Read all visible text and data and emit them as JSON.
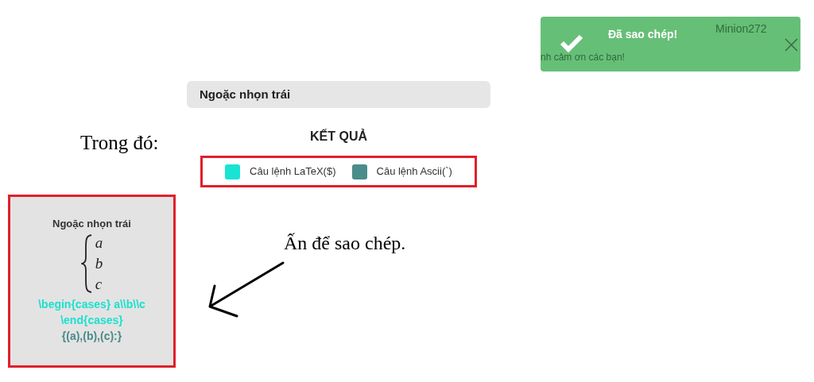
{
  "toast": {
    "message": "Đã sao chép!",
    "background_texts": [
      "Minion272",
      "nh cảm ơn các bạn!"
    ]
  },
  "symbol_header": "Ngoặc nhọn trái",
  "annotations": [
    "Trong đó:",
    "Ấn để sao chép."
  ],
  "result_title": "KẾT QUẢ",
  "legend": [
    {
      "label": "Câu lệnh LaTeX($)",
      "color": "#19e3d3"
    },
    {
      "label": "Câu lệnh Ascii(`)",
      "color": "#4a8d8a"
    }
  ],
  "card": {
    "title": "Ngoặc nhọn trái",
    "cases": [
      "a",
      "b",
      "c"
    ],
    "latex": "\\begin{cases} a\\\\b\\\\c \\end{cases}",
    "ascii": "{(a),(b),(c):}"
  }
}
